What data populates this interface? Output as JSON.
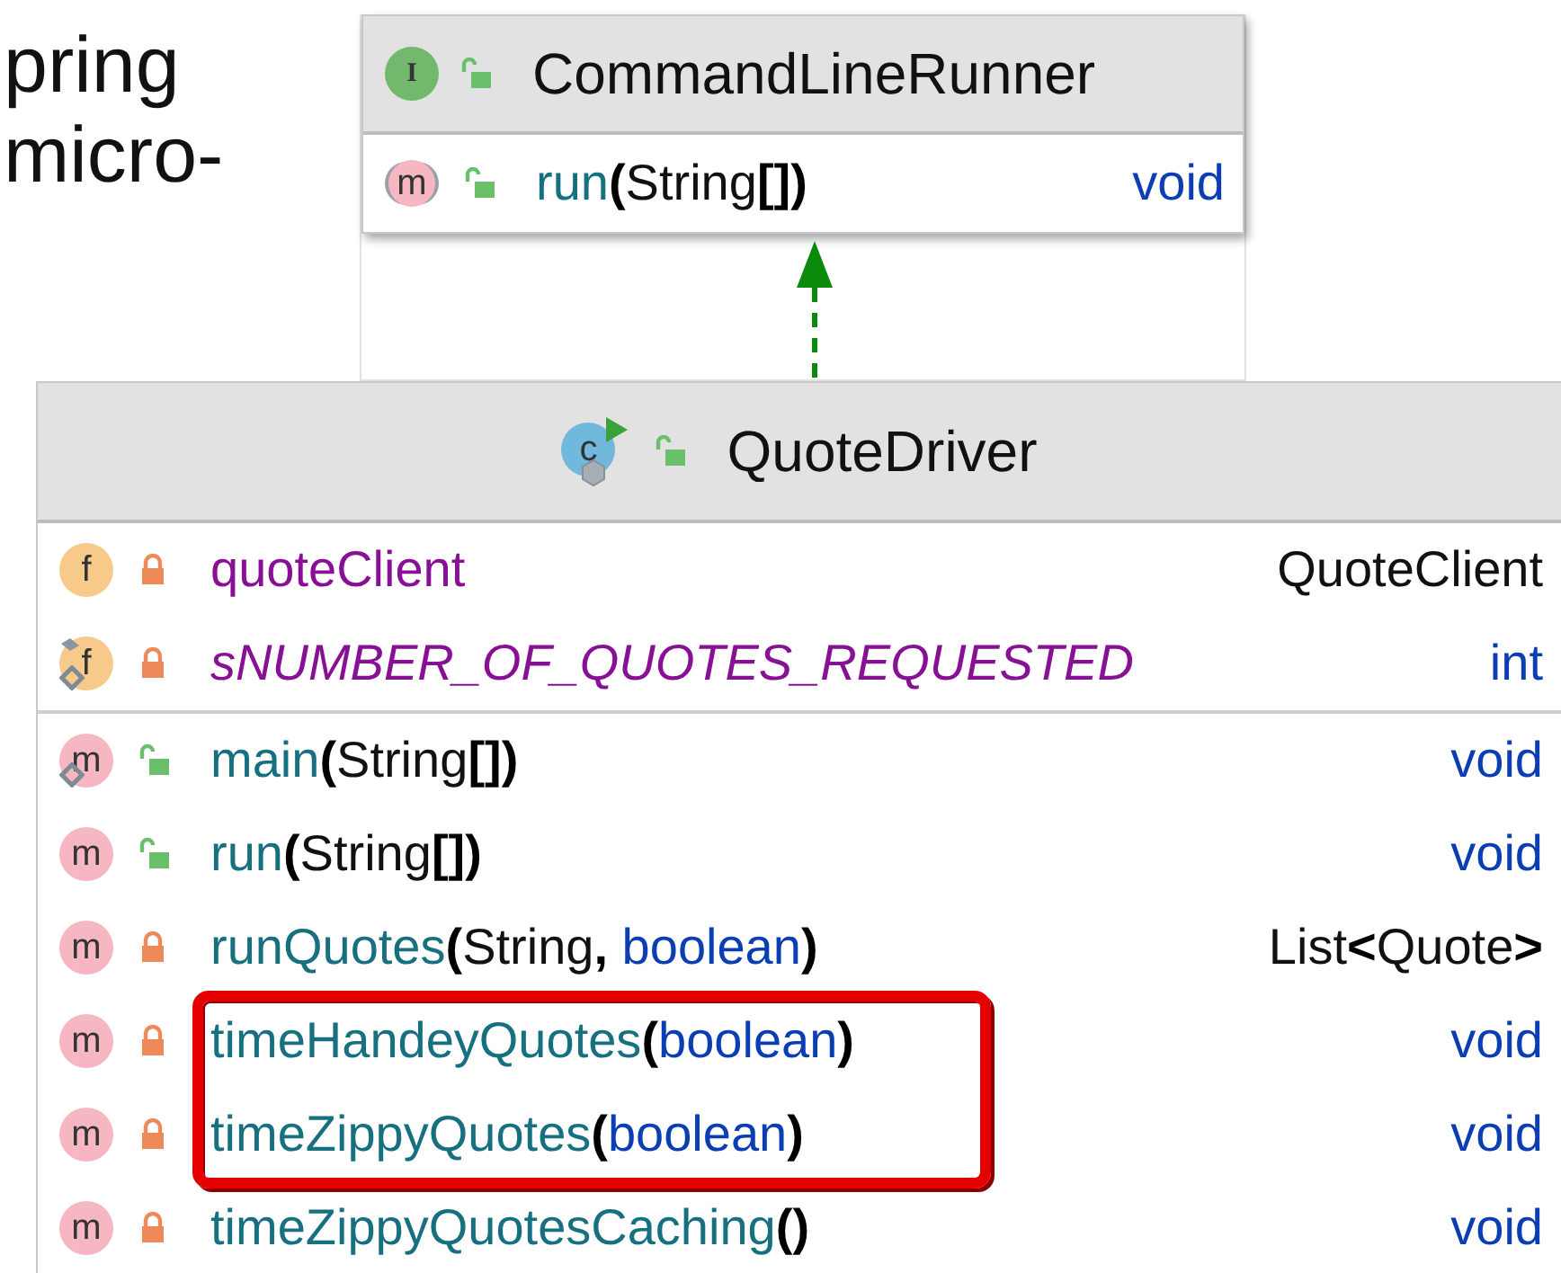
{
  "slide_text": [
    "pring",
    "micro-"
  ],
  "diagram": {
    "interface": {
      "kind": "interface",
      "badge": "I",
      "locked": false,
      "name": "CommandLineRunner",
      "members": [
        {
          "kind": "method",
          "badge": "m",
          "abstract": true,
          "static": false,
          "final": false,
          "locked": false,
          "highlighted": false,
          "signature": [
            {
              "text": "run",
              "kind": "name"
            },
            {
              "text": "(",
              "kind": "punct"
            },
            {
              "text": "String",
              "kind": "type"
            },
            {
              "text": "[])",
              "kind": "punct"
            }
          ],
          "returns": [
            {
              "text": "void",
              "kind": "primitive"
            }
          ]
        }
      ]
    },
    "relation": {
      "kind": "implements"
    },
    "class": {
      "kind": "class",
      "badge": "c",
      "locked": false,
      "name": "QuoteDriver",
      "sections": [
        {
          "members": [
            {
              "kind": "field",
              "badge": "f",
              "abstract": false,
              "static": false,
              "final": false,
              "locked": true,
              "highlighted": false,
              "signature": [
                {
                  "text": "quoteClient",
                  "kind": "field"
                }
              ],
              "returns": [
                {
                  "text": "QuoteClient",
                  "kind": "type"
                }
              ]
            },
            {
              "kind": "field",
              "badge": "f",
              "abstract": false,
              "static": true,
              "final": true,
              "locked": true,
              "highlighted": false,
              "signature": [
                {
                  "text": "sNUMBER_OF_QUOTES_REQUESTED",
                  "kind": "field"
                }
              ],
              "returns": [
                {
                  "text": "int",
                  "kind": "primitive"
                }
              ]
            }
          ]
        },
        {
          "members": [
            {
              "kind": "method",
              "badge": "m",
              "abstract": false,
              "static": true,
              "final": false,
              "locked": false,
              "highlighted": false,
              "signature": [
                {
                  "text": "main",
                  "kind": "name"
                },
                {
                  "text": "(",
                  "kind": "punct"
                },
                {
                  "text": "String",
                  "kind": "type"
                },
                {
                  "text": "[])",
                  "kind": "punct"
                }
              ],
              "returns": [
                {
                  "text": "void",
                  "kind": "primitive"
                }
              ]
            },
            {
              "kind": "method",
              "badge": "m",
              "abstract": false,
              "static": false,
              "final": false,
              "locked": false,
              "highlighted": false,
              "signature": [
                {
                  "text": "run",
                  "kind": "name"
                },
                {
                  "text": "(",
                  "kind": "punct"
                },
                {
                  "text": "String",
                  "kind": "type"
                },
                {
                  "text": "[])",
                  "kind": "punct"
                }
              ],
              "returns": [
                {
                  "text": "void",
                  "kind": "primitive"
                }
              ]
            },
            {
              "kind": "method",
              "badge": "m",
              "abstract": false,
              "static": false,
              "final": false,
              "locked": true,
              "highlighted": false,
              "signature": [
                {
                  "text": "runQuotes",
                  "kind": "name"
                },
                {
                  "text": "(",
                  "kind": "punct"
                },
                {
                  "text": "String",
                  "kind": "type"
                },
                {
                  "text": ", ",
                  "kind": "punct"
                },
                {
                  "text": "boolean",
                  "kind": "primitive"
                },
                {
                  "text": ")",
                  "kind": "punct"
                }
              ],
              "returns": [
                {
                  "text": "List",
                  "kind": "type"
                },
                {
                  "text": "<",
                  "kind": "punct"
                },
                {
                  "text": "Quote",
                  "kind": "type"
                },
                {
                  "text": ">",
                  "kind": "punct"
                }
              ]
            },
            {
              "kind": "method",
              "badge": "m",
              "abstract": false,
              "static": false,
              "final": false,
              "locked": true,
              "highlighted": true,
              "signature": [
                {
                  "text": "timeHandeyQuotes",
                  "kind": "name"
                },
                {
                  "text": "(",
                  "kind": "punct"
                },
                {
                  "text": "boolean",
                  "kind": "primitive"
                },
                {
                  "text": ")",
                  "kind": "punct"
                }
              ],
              "returns": [
                {
                  "text": "void",
                  "kind": "primitive"
                }
              ]
            },
            {
              "kind": "method",
              "badge": "m",
              "abstract": false,
              "static": false,
              "final": false,
              "locked": true,
              "highlighted": true,
              "signature": [
                {
                  "text": "timeZippyQuotes",
                  "kind": "name"
                },
                {
                  "text": "(",
                  "kind": "punct"
                },
                {
                  "text": "boolean",
                  "kind": "primitive"
                },
                {
                  "text": ")",
                  "kind": "punct"
                }
              ],
              "returns": [
                {
                  "text": "void",
                  "kind": "primitive"
                }
              ]
            },
            {
              "kind": "method",
              "badge": "m",
              "abstract": false,
              "static": false,
              "final": false,
              "locked": true,
              "highlighted": false,
              "signature": [
                {
                  "text": "timeZippyQuotesCaching",
                  "kind": "name"
                },
                {
                  "text": "()",
                  "kind": "punct"
                }
              ],
              "returns": [
                {
                  "text": "void",
                  "kind": "primitive"
                }
              ]
            }
          ]
        }
      ]
    }
  }
}
